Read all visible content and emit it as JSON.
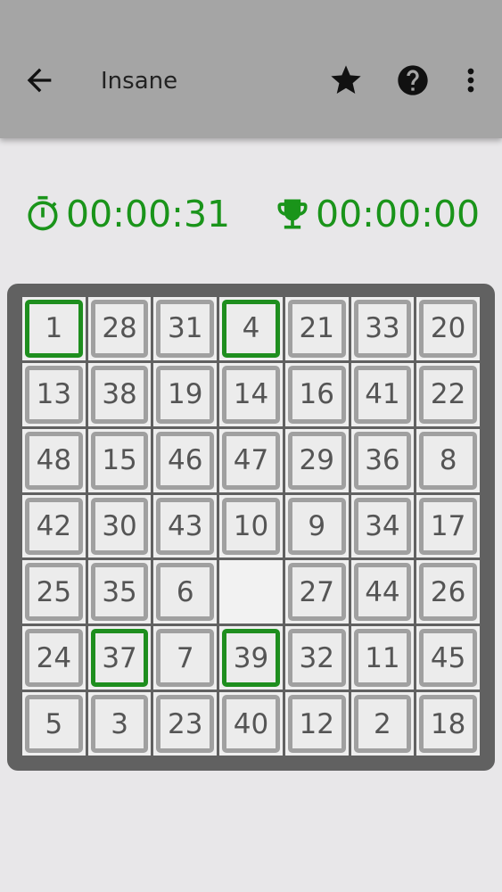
{
  "app_bar": {
    "title": "Insane",
    "icons": {
      "back": "arrow-back-icon",
      "favorite": "star-icon",
      "help": "help-circle-icon",
      "menu": "more-vert-icon"
    },
    "colors": {
      "bar": "#a5a5a5",
      "icon": "#111111"
    }
  },
  "timers": {
    "elapsed": "00:00:31",
    "best": "00:00:00",
    "elapsed_icon": "stopwatch-icon",
    "best_icon": "trophy-icon",
    "color": "#1a941a"
  },
  "board": {
    "rows": 7,
    "cols": 7,
    "empty_value": 0,
    "tiles": [
      [
        1,
        28,
        31,
        4,
        21,
        33,
        20
      ],
      [
        13,
        38,
        19,
        14,
        16,
        41,
        22
      ],
      [
        48,
        15,
        46,
        47,
        29,
        36,
        8
      ],
      [
        42,
        30,
        43,
        10,
        9,
        34,
        17
      ],
      [
        25,
        35,
        6,
        0,
        27,
        44,
        26
      ],
      [
        24,
        37,
        7,
        39,
        32,
        11,
        45
      ],
      [
        5,
        3,
        23,
        40,
        12,
        2,
        18
      ]
    ],
    "correct_tiles": [
      1,
      4,
      37,
      39
    ],
    "colors": {
      "frame": "#616161",
      "tile_border": "#a0a0a0",
      "correct_border": "#1e8e1e",
      "tile_text": "#555555"
    }
  }
}
